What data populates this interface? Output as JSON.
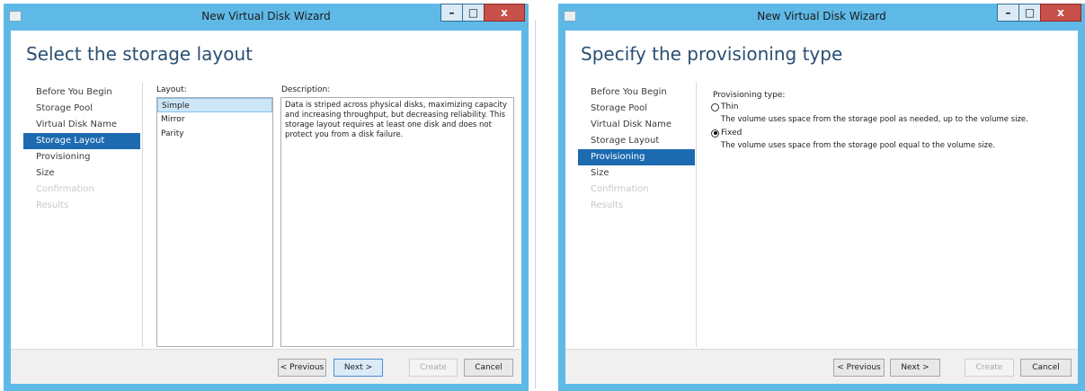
{
  "left_window": {
    "title": "New Virtual Disk Wizard",
    "heading": "Select the storage layout",
    "nav": [
      "Before You Begin",
      "Storage Pool",
      "Virtual Disk Name",
      "Storage Layout",
      "Provisioning",
      "Size",
      "Confirmation",
      "Results"
    ],
    "active_step": "Storage Layout",
    "layout_label": "Layout:",
    "layouts": [
      "Simple",
      "Mirror",
      "Parity"
    ],
    "selected_layout": "Simple",
    "description_label": "Description:",
    "description": "Data is striped across physical disks, maximizing capacity and increasing throughput, but decreasing reliability. This storage layout requires at least one disk and does not protect you from a disk failure.",
    "buttons": {
      "previous": "< Previous",
      "next": "Next >",
      "create": "Create",
      "cancel": "Cancel"
    },
    "caption": {
      "minimize": "–",
      "maximize": "□",
      "close": "x"
    }
  },
  "right_window": {
    "title": "New Virtual Disk Wizard",
    "heading": "Specify the provisioning type",
    "nav": [
      "Before You Begin",
      "Storage Pool",
      "Virtual Disk Name",
      "Storage Layout",
      "Provisioning",
      "Size",
      "Confirmation",
      "Results"
    ],
    "active_step": "Provisioning",
    "provisioning_label": "Provisioning type:",
    "options": [
      {
        "label": "Thin",
        "description": "The volume uses space from the storage pool as needed, up to the volume size.",
        "checked": false
      },
      {
        "label": "Fixed",
        "description": "The volume uses space from the storage pool equal to the volume size.",
        "checked": true
      }
    ],
    "buttons": {
      "previous": "< Previous",
      "next": "Next >",
      "create": "Create",
      "cancel": "Cancel"
    },
    "caption": {
      "minimize": "–",
      "maximize": "□",
      "close": "x"
    }
  },
  "colors": {
    "title_bar": "#5fb9e6",
    "accent": "#1c6ab0",
    "heading": "#2a4f73",
    "close": "#c7504a"
  }
}
